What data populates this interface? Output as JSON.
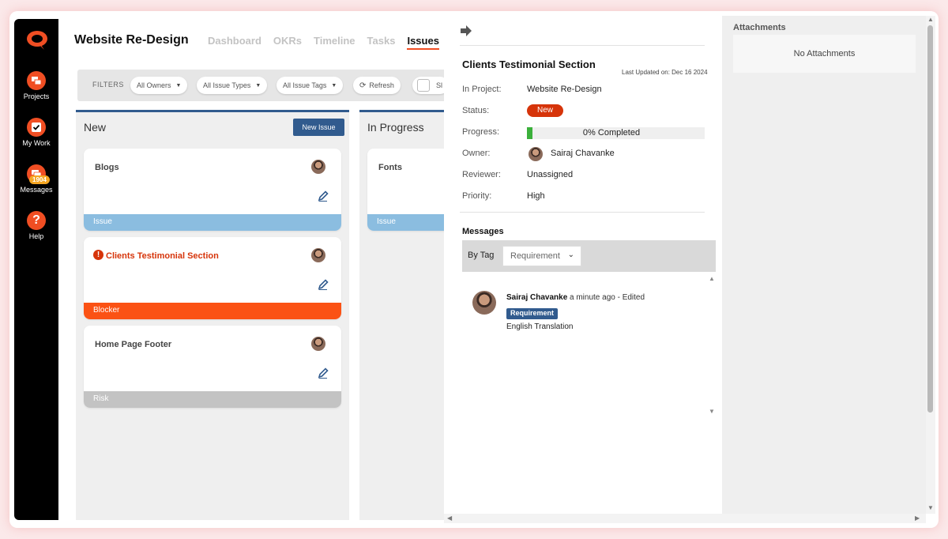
{
  "sidebar": {
    "items": [
      {
        "label": "Projects",
        "icon": "projects-icon"
      },
      {
        "label": "My Work",
        "icon": "checkmark-icon"
      },
      {
        "label": "Messages",
        "icon": "messages-icon",
        "badge": "1904"
      },
      {
        "label": "Help",
        "icon": "help-icon"
      }
    ]
  },
  "header": {
    "project_title": "Website Re-Design",
    "tabs": [
      "Dashboard",
      "OKRs",
      "Timeline",
      "Tasks",
      "Issues"
    ],
    "active_tab": "Issues"
  },
  "filters": {
    "label": "FILTERS",
    "owners": "All Owners",
    "issue_types": "All Issue Types",
    "issue_tags": "All Issue Tags",
    "refresh": "Refresh",
    "partial_option": "Sl"
  },
  "columns": [
    {
      "title": "New",
      "button": "New Issue",
      "cards": [
        {
          "title": "Blogs",
          "tag": "Issue",
          "tag_color": "#8bbde0"
        },
        {
          "title": "Clients Testimonial Section",
          "tag": "Blocker",
          "tag_color": "#fb5214",
          "warning": true
        },
        {
          "title": "Home Page Footer",
          "tag": "Risk",
          "tag_color": "#c3c3c3"
        }
      ]
    },
    {
      "title": "In Progress",
      "cards": [
        {
          "title": "Fonts",
          "tag": "Issue",
          "tag_color": "#8bbde0"
        }
      ]
    }
  ],
  "detail": {
    "title": "Clients Testimonial Section",
    "last_updated": "Last Updated on: Dec 16 2024",
    "fields": {
      "in_project_label": "In Project:",
      "in_project": "Website Re-Design",
      "status_label": "Status:",
      "status": "New",
      "progress_label": "Progress:",
      "progress_text": "0% Completed",
      "progress_value": 0,
      "owner_label": "Owner:",
      "owner": "Sairaj Chavanke",
      "reviewer_label": "Reviewer:",
      "reviewer": "Unassigned",
      "priority_label": "Priority:",
      "priority": "High"
    },
    "messages": {
      "label": "Messages",
      "by_tag_label": "By Tag",
      "tag_filter": "Requirement",
      "items": [
        {
          "author": "Sairaj Chavanke",
          "time": "a minute ago - Edited",
          "tag": "Requirement",
          "text": "English Translation"
        }
      ]
    }
  },
  "attachments": {
    "title": "Attachments",
    "empty_text": "No Attachments"
  },
  "colors": {
    "accent": "#f04e23",
    "primary_blue": "#315b8e",
    "status_new": "#d6340a",
    "progress_green": "#3bb03b"
  }
}
